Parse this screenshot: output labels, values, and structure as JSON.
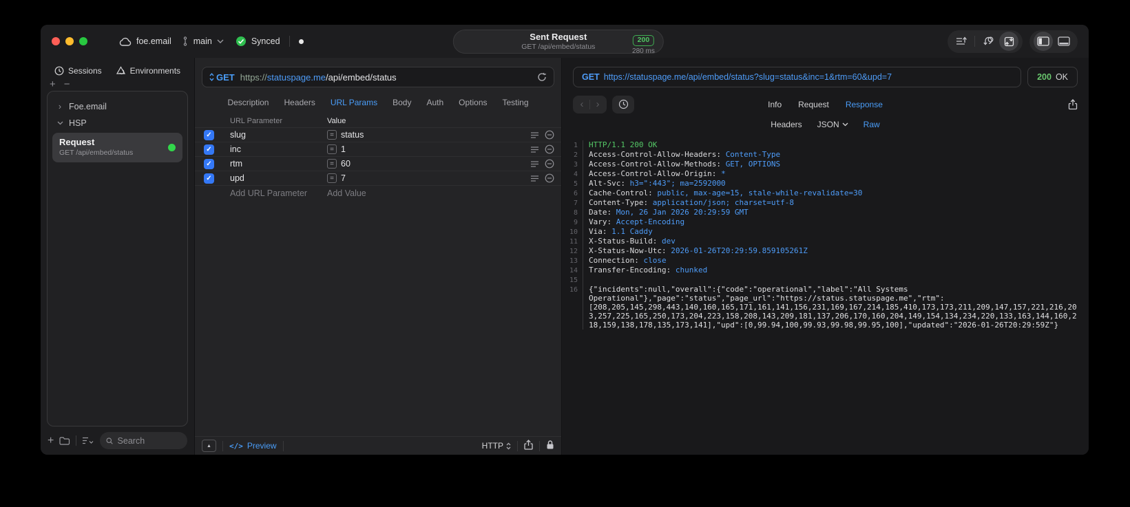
{
  "titlebar": {
    "project": "foe.email",
    "branch": "main",
    "sync_label": "Synced",
    "center": {
      "title": "Sent Request",
      "subtitle": "GET /api/embed/status",
      "status_code": "200",
      "duration": "280 ms"
    }
  },
  "sidebar": {
    "tabs": [
      {
        "label": "Sessions"
      },
      {
        "label": "Environments"
      }
    ],
    "tree": [
      {
        "label": "Foe.email"
      },
      {
        "label": "HSP"
      }
    ],
    "request_item": {
      "title": "Request",
      "subtitle": "GET /api/embed/status"
    },
    "search_placeholder": "Search"
  },
  "request_panel": {
    "method": "GET",
    "url": {
      "scheme": "https://",
      "host": "statuspage.me",
      "path": "/api/embed/status"
    },
    "tabs": [
      "Description",
      "Headers",
      "URL Params",
      "Body",
      "Auth",
      "Options",
      "Testing"
    ],
    "active_tab": "URL Params",
    "param_table": {
      "columns": [
        "URL Parameter",
        "Value"
      ],
      "rows": [
        {
          "enabled": true,
          "name": "slug",
          "value": "status"
        },
        {
          "enabled": true,
          "name": "inc",
          "value": "1"
        },
        {
          "enabled": true,
          "name": "rtm",
          "value": "60"
        },
        {
          "enabled": true,
          "name": "upd",
          "value": "7"
        }
      ],
      "add_param_placeholder": "Add URL Parameter",
      "add_value_placeholder": "Add Value"
    },
    "footer": {
      "code_glyph": "</>",
      "preview_label": "Preview",
      "protocol": "HTTP"
    }
  },
  "response_panel": {
    "request_method": "GET",
    "request_url": "https://statuspage.me/api/embed/status?slug=status&inc=1&rtm=60&upd=7",
    "status_code": "200",
    "status_text": "OK",
    "tabs": [
      "Info",
      "Request",
      "Response"
    ],
    "active_tab": "Response",
    "subtabs": [
      {
        "label": "Headers",
        "has_menu": false
      },
      {
        "label": "JSON",
        "has_menu": true
      },
      {
        "label": "Raw",
        "has_menu": false
      }
    ],
    "active_subtab": "Raw",
    "body": {
      "status_line": "HTTP/1.1 200 OK",
      "headers": [
        {
          "name": "Access-Control-Allow-Headers",
          "value": "Content-Type"
        },
        {
          "name": "Access-Control-Allow-Methods",
          "value": "GET, OPTIONS"
        },
        {
          "name": "Access-Control-Allow-Origin",
          "value": "*"
        },
        {
          "name": "Alt-Svc",
          "value": "h3=\":443\"; ma=2592000"
        },
        {
          "name": "Cache-Control",
          "value": "public, max-age=15, stale-while-revalidate=30"
        },
        {
          "name": "Content-Type",
          "value": "application/json; charset=utf-8"
        },
        {
          "name": "Date",
          "value": "Mon, 26 Jan 2026 20:29:59 GMT"
        },
        {
          "name": "Vary",
          "value": "Accept-Encoding"
        },
        {
          "name": "Via",
          "value": "1.1 Caddy"
        },
        {
          "name": "X-Status-Build",
          "value": "dev"
        },
        {
          "name": "X-Status-Now-Utc",
          "value": "2026-01-26T20:29:59.859105261Z"
        },
        {
          "name": "Connection",
          "value": "close"
        },
        {
          "name": "Transfer-Encoding",
          "value": "chunked"
        }
      ],
      "json": "{\"incidents\":null,\"overall\":{\"code\":\"operational\",\"label\":\"All Systems Operational\"},\"page\":\"status\",\"page_url\":\"https://status.statuspage.me\",\"rtm\":[208,205,145,298,443,140,160,165,171,161,141,156,231,169,167,214,185,410,173,173,211,209,147,157,221,216,203,257,225,165,250,173,204,223,158,208,143,209,181,137,206,170,160,204,149,154,134,234,220,133,163,144,160,218,159,138,178,135,173,141],\"upd\":[0,99.94,100,99.93,99.98,99.95,100],\"updated\":\"2026-01-26T20:29:59Z\"}"
    }
  },
  "colors": {
    "accent": "#4a9df8",
    "green": "#32d74b",
    "status_green": "#54c766"
  }
}
